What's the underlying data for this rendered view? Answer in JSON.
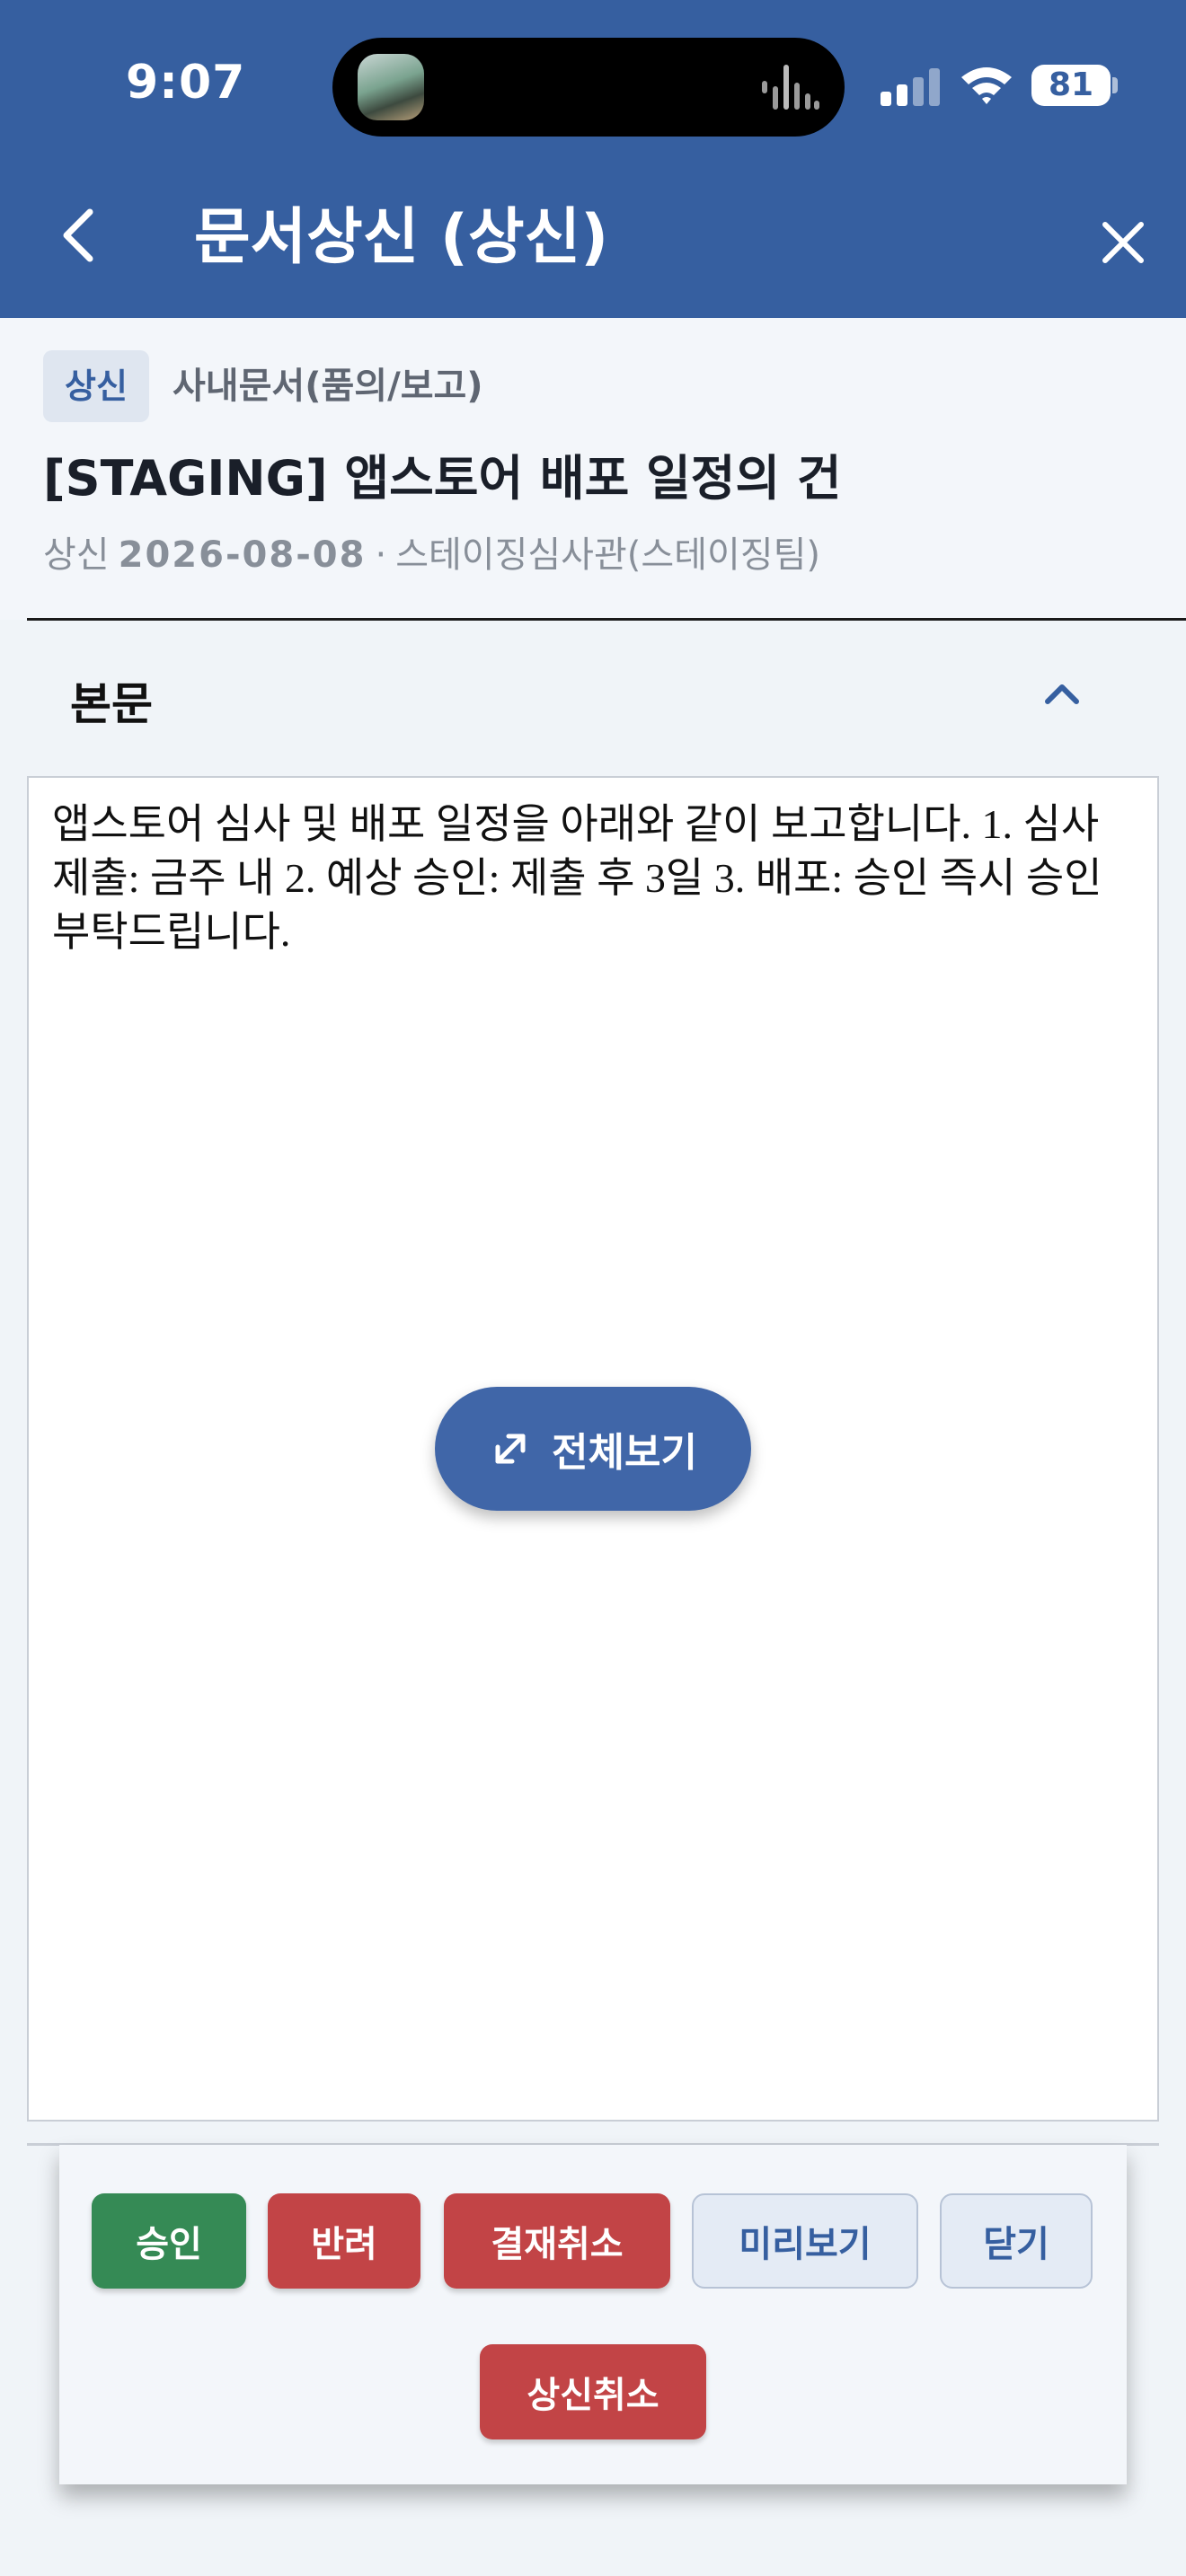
{
  "status_bar": {
    "time": "9:07",
    "battery": "81"
  },
  "nav": {
    "title": "문서상신 (상신)",
    "back_icon": "chevron-left-icon",
    "close_icon": "close-icon"
  },
  "document": {
    "status_badge": "상신",
    "category": "사내문서(품의/보고)",
    "title": "[STAGING] 앱스토어 배포 일정의 건",
    "meta_prefix": "상신",
    "date": "2026-08-08",
    "separator": "·",
    "author": "스테이징심사관(스테이징팀)"
  },
  "section": {
    "title": "본문",
    "toggle_icon": "chevron-up-icon"
  },
  "body": {
    "text": "앱스토어 심사 및 배포 일정을 아래와 같이 보고합니다. 1. 심사 제출: 금주 내 2. 예상 승인: 제출 후 3일 3. 배포: 승인 즉시 승인 부탁드립니다.",
    "fullview_label": "전체보기"
  },
  "actions": {
    "approve": "승인",
    "reject": "반려",
    "cancel_approval": "결재취소",
    "preview": "미리보기",
    "close": "닫기",
    "withdraw": "상신취소"
  },
  "colors": {
    "header": "#365fa0",
    "approve": "#358a55",
    "danger": "#c24446",
    "fab": "#4066a8"
  }
}
